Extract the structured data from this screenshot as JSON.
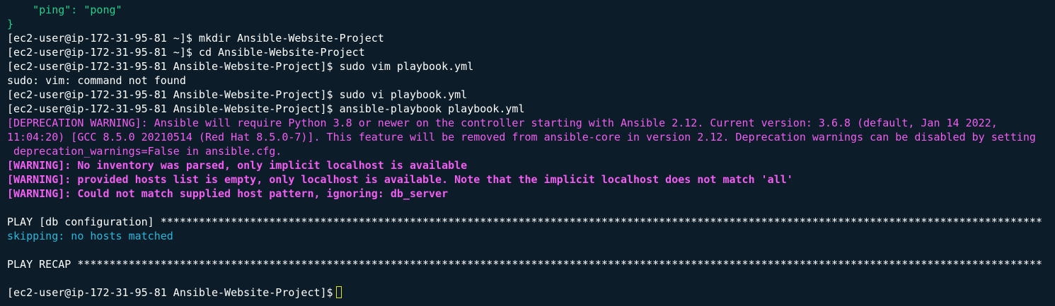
{
  "terminal": {
    "colors": {
      "background": "#0c1c29",
      "default_text": "#ffffff",
      "output_green": "#23d18b",
      "warning_magenta": "#f25ef2",
      "skipping_cyan": "#29b8db",
      "cursor_outline": "#e5e510"
    },
    "lines": [
      "    \"ping\": \"pong\"",
      "}",
      "[ec2-user@ip-172-31-95-81 ~]$ mkdir Ansible-Website-Project",
      "[ec2-user@ip-172-31-95-81 ~]$ cd Ansible-Website-Project",
      "[ec2-user@ip-172-31-95-81 Ansible-Website-Project]$ sudo vim playbook.yml",
      "sudo: vim: command not found",
      "[ec2-user@ip-172-31-95-81 Ansible-Website-Project]$ sudo vi playbook.yml",
      "[ec2-user@ip-172-31-95-81 Ansible-Website-Project]$ ansible-playbook playbook.yml",
      "[DEPRECATION WARNING]: Ansible will require Python 3.8 or newer on the controller starting with Ansible 2.12. Current version: 3.6.8 (default, Jan 14 2022,",
      "11:04:20) [GCC 8.5.0 20210514 (Red Hat 8.5.0-7)]. This feature will be removed from ansible-core in version 2.12. Deprecation warnings can be disabled by setting",
      " deprecation_warnings=False in ansible.cfg.",
      "[WARNING]: No inventory was parsed, only implicit localhost is available",
      "[WARNING]: provided hosts list is empty, only localhost is available. Note that the implicit localhost does not match 'all'",
      "[WARNING]: Could not match supplied host pattern, ignoring: db_server",
      "",
      "PLAY [db configuration] ******************************************************************************************************************************************",
      "skipping: no hosts matched",
      "",
      "PLAY RECAP *******************************************************************************************************************************************************",
      "",
      "[ec2-user@ip-172-31-95-81 Ansible-Website-Project]$"
    ]
  }
}
